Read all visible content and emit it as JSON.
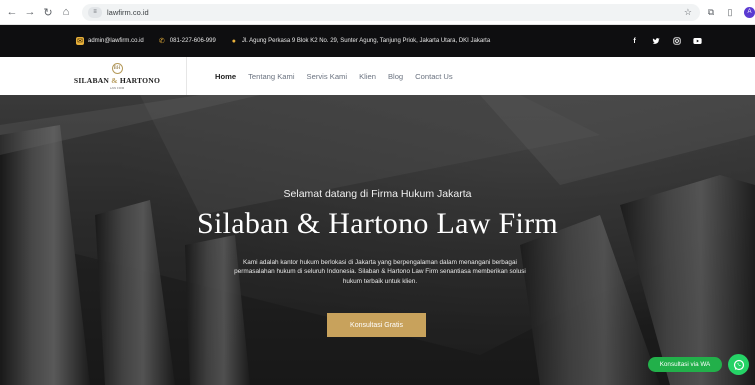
{
  "browser": {
    "url": "lawfirm.co.id",
    "back_icon": "arrow-left-icon",
    "forward_icon": "arrow-right-icon",
    "reload_icon": "reload-icon",
    "home_icon": "home-icon",
    "profile_initial": "A"
  },
  "topbar": {
    "email": "admin@lawfirm.co.id",
    "phone": "081-227-606-999",
    "address": "Jl. Agung Perkasa 9 Blok K2 No. 29, Sunter Agung, Tanjung Priok, Jakarta Utara, DKI Jakarta",
    "socials": [
      "f",
      "t",
      "ig",
      "yt"
    ]
  },
  "logo": {
    "mark": "BH",
    "name_left": "SILABAN",
    "amp": "&",
    "name_right": "HARTONO",
    "tagline": "LAW FIRM"
  },
  "nav": {
    "items": [
      "Home",
      "Tentang Kami",
      "Servis Kami",
      "Klien",
      "Blog",
      "Contact Us"
    ]
  },
  "hero": {
    "welcome": "Selamat datang di Firma Hukum Jakarta",
    "headline": "Silaban & Hartono Law Firm",
    "description": "Kami adalah kantor hukum berlokasi di Jakarta yang berpengalaman dalam menangani berbagai permasalahan hukum di seluruh Indonesia. Silaban & Hartono Law Firm senantiasa memberikan solusi hukum terbaik untuk klien.",
    "cta": "Konsultasi Gratis"
  },
  "whatsapp": {
    "label": "Konsultasi via WA"
  },
  "colors": {
    "accent": "#c8a25c",
    "topbar_bg": "#0e0e10",
    "whatsapp": "#25d366"
  }
}
